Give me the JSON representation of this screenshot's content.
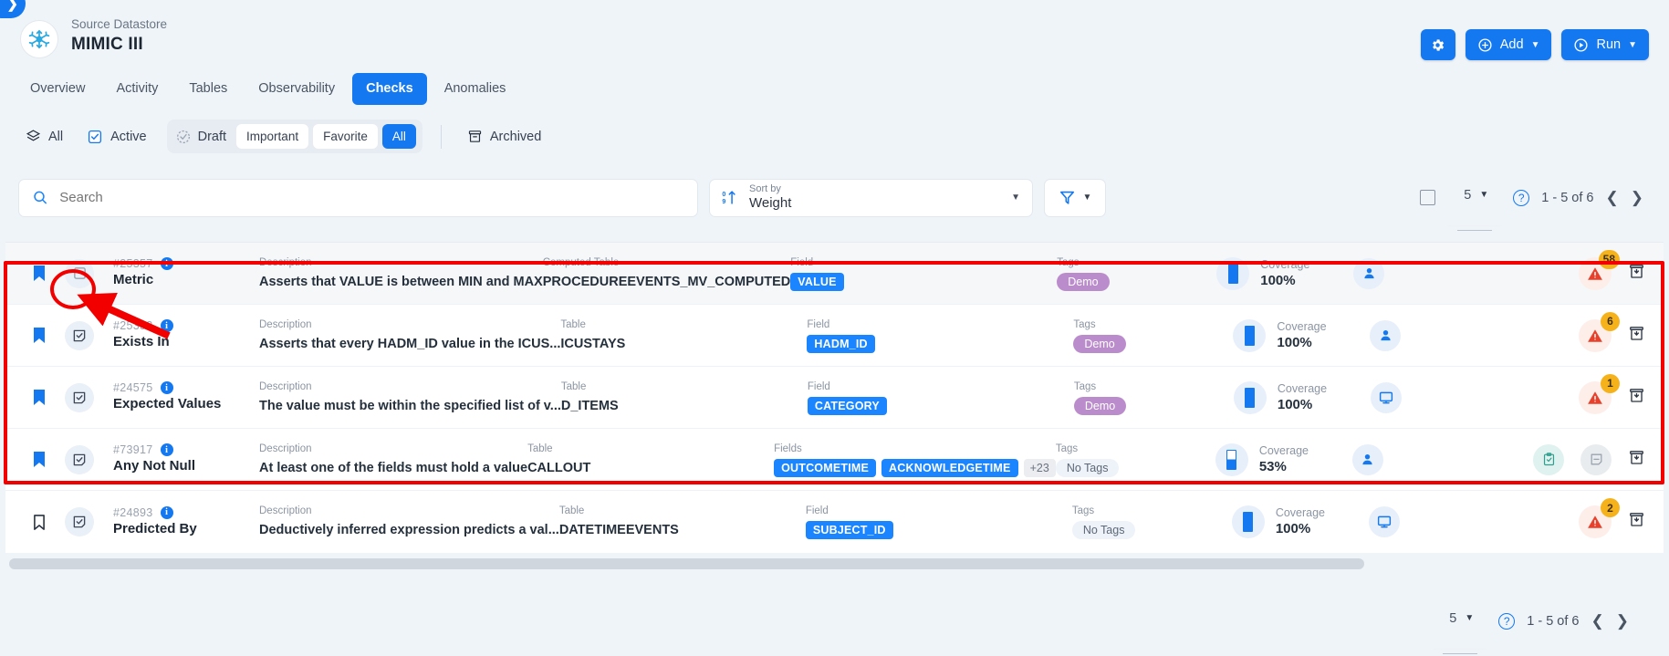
{
  "sidebar_toggle": {
    "icon": "chevron-right-icon"
  },
  "header": {
    "logo_icon": "snowflake-icon",
    "subtitle": "Source Datastore",
    "title": "MIMIC III",
    "actions": {
      "settings_icon": "gear-icon",
      "add_label": "Add",
      "add_icon": "plus-circle-icon",
      "run_label": "Run",
      "run_icon": "play-circle-icon",
      "caret_icon": "chevron-down-icon"
    }
  },
  "tabs": [
    {
      "label": "Overview",
      "active": false
    },
    {
      "label": "Activity",
      "active": false
    },
    {
      "label": "Tables",
      "active": false
    },
    {
      "label": "Observability",
      "active": false
    },
    {
      "label": "Checks",
      "active": true
    },
    {
      "label": "Anomalies",
      "active": false
    }
  ],
  "filterbar": {
    "all_label": "All",
    "all_icon": "layers-icon",
    "active_label": "Active",
    "active_icon": "checkbox-icon",
    "draft_label": "Draft",
    "draft_icon": "draft-circle-icon",
    "pills": [
      {
        "label": "Important",
        "active": false
      },
      {
        "label": "Favorite",
        "active": false
      },
      {
        "label": "All",
        "active": true
      }
    ],
    "archived_label": "Archived",
    "archived_icon": "archive-icon"
  },
  "search": {
    "placeholder": "Search",
    "value": "",
    "icon": "search-icon"
  },
  "sort": {
    "label": "Sort by",
    "value": "Weight",
    "icon": "sort-az-icon",
    "caret": "chevron-down-icon"
  },
  "filter_button": {
    "icon": "funnel-icon",
    "caret": "chevron-down-icon"
  },
  "pagination_top": {
    "select_all_icon": "checkbox-empty-icon",
    "page_size": "5",
    "page_size_caret": "chevron-down-icon",
    "help_icon": "question-icon",
    "range": "1 - 5 of 6",
    "prev_icon": "chevron-left-icon",
    "next_icon": "chevron-right-icon"
  },
  "pagination_bottom": {
    "page_size": "5",
    "page_size_caret": "chevron-down-icon",
    "help_icon": "question-icon",
    "range": "1 - 5 of 6",
    "prev_icon": "chevron-left-icon",
    "next_icon": "chevron-right-icon"
  },
  "colors": {
    "accent": "#1478f0",
    "tag_blue": "#1a85ff",
    "tag_purple": "#bb8ccc",
    "alert_red": "#e8402a",
    "badge_amber": "#f6b21b",
    "annotation_red": "#f20000",
    "page_bg": "#eff4f9"
  },
  "rows": [
    {
      "bookmarked": true,
      "type_icon": "square-empty-icon",
      "id": "#25357",
      "info_icon": "info-icon",
      "name": "Metric",
      "desc_label": "Description",
      "desc": "Asserts that VALUE is between MIN and MAX",
      "table_label": "Computed Table",
      "table": "PROCEDUREEVENTS_MV_COMPUTED",
      "field_label": "Field",
      "fields": [
        "VALUE"
      ],
      "field_more": "",
      "tags_label": "Tags",
      "tags": [
        "Demo"
      ],
      "coverage_label": "Coverage",
      "coverage": "100%",
      "coverage_pct": 100,
      "owner_icon": "person-icon",
      "extra_icons": [],
      "alert_icon": "warning-triangle-icon",
      "alert_count": "58",
      "archive_icon": "archive-box-icon",
      "highlighted": true
    },
    {
      "bookmarked": true,
      "type_icon": "checked-note-icon",
      "id": "#25352",
      "info_icon": "info-icon",
      "name": "Exists In",
      "desc_label": "Description",
      "desc": "Asserts that every HADM_ID value in the ICUS...",
      "table_label": "Table",
      "table": "ICUSTAYS",
      "field_label": "Field",
      "fields": [
        "HADM_ID"
      ],
      "field_more": "",
      "tags_label": "Tags",
      "tags": [
        "Demo"
      ],
      "coverage_label": "Coverage",
      "coverage": "100%",
      "coverage_pct": 100,
      "owner_icon": "person-icon",
      "extra_icons": [],
      "alert_icon": "warning-triangle-icon",
      "alert_count": "6",
      "archive_icon": "archive-box-icon",
      "highlighted": false
    },
    {
      "bookmarked": true,
      "type_icon": "checked-note-icon",
      "id": "#24575",
      "info_icon": "info-icon",
      "name": "Expected Values",
      "desc_label": "Description",
      "desc": "The value must be within the specified list of v...",
      "table_label": "Table",
      "table": "D_ITEMS",
      "field_label": "Field",
      "fields": [
        "CATEGORY"
      ],
      "field_more": "",
      "tags_label": "Tags",
      "tags": [
        "Demo"
      ],
      "coverage_label": "Coverage",
      "coverage": "100%",
      "coverage_pct": 100,
      "owner_icon": "monitor-icon",
      "extra_icons": [],
      "alert_icon": "warning-triangle-icon",
      "alert_count": "1",
      "archive_icon": "archive-box-icon",
      "highlighted": false
    },
    {
      "bookmarked": true,
      "type_icon": "checked-note-icon",
      "id": "#73917",
      "info_icon": "info-icon",
      "name": "Any Not Null",
      "desc_label": "Description",
      "desc": "At least one of the fields must hold a value",
      "table_label": "Table",
      "table": "CALLOUT",
      "field_label": "Fields",
      "fields": [
        "OUTCOMETIME",
        "ACKNOWLEDGETIME"
      ],
      "field_more": "+23",
      "tags_label": "Tags",
      "tags": [
        "No Tags"
      ],
      "coverage_label": "Coverage",
      "coverage": "53%",
      "coverage_pct": 53,
      "owner_icon": "person-icon",
      "extra_icons": [
        "clipboard-check-icon",
        "minus-note-icon"
      ],
      "alert_icon": "",
      "alert_count": "",
      "archive_icon": "archive-box-icon",
      "highlighted": false
    },
    {
      "bookmarked": false,
      "type_icon": "checked-note-icon",
      "id": "#24893",
      "info_icon": "info-icon",
      "name": "Predicted By",
      "desc_label": "Description",
      "desc": "Deductively inferred expression predicts a val...",
      "table_label": "Table",
      "table": "DATETIMEEVENTS",
      "field_label": "Field",
      "fields": [
        "SUBJECT_ID"
      ],
      "field_more": "",
      "tags_label": "Tags",
      "tags": [
        "No Tags"
      ],
      "coverage_label": "Coverage",
      "coverage": "100%",
      "coverage_pct": 100,
      "owner_icon": "monitor-icon",
      "extra_icons": [],
      "alert_icon": "warning-triangle-icon",
      "alert_count": "2",
      "archive_icon": "archive-box-icon",
      "highlighted": false
    }
  ]
}
